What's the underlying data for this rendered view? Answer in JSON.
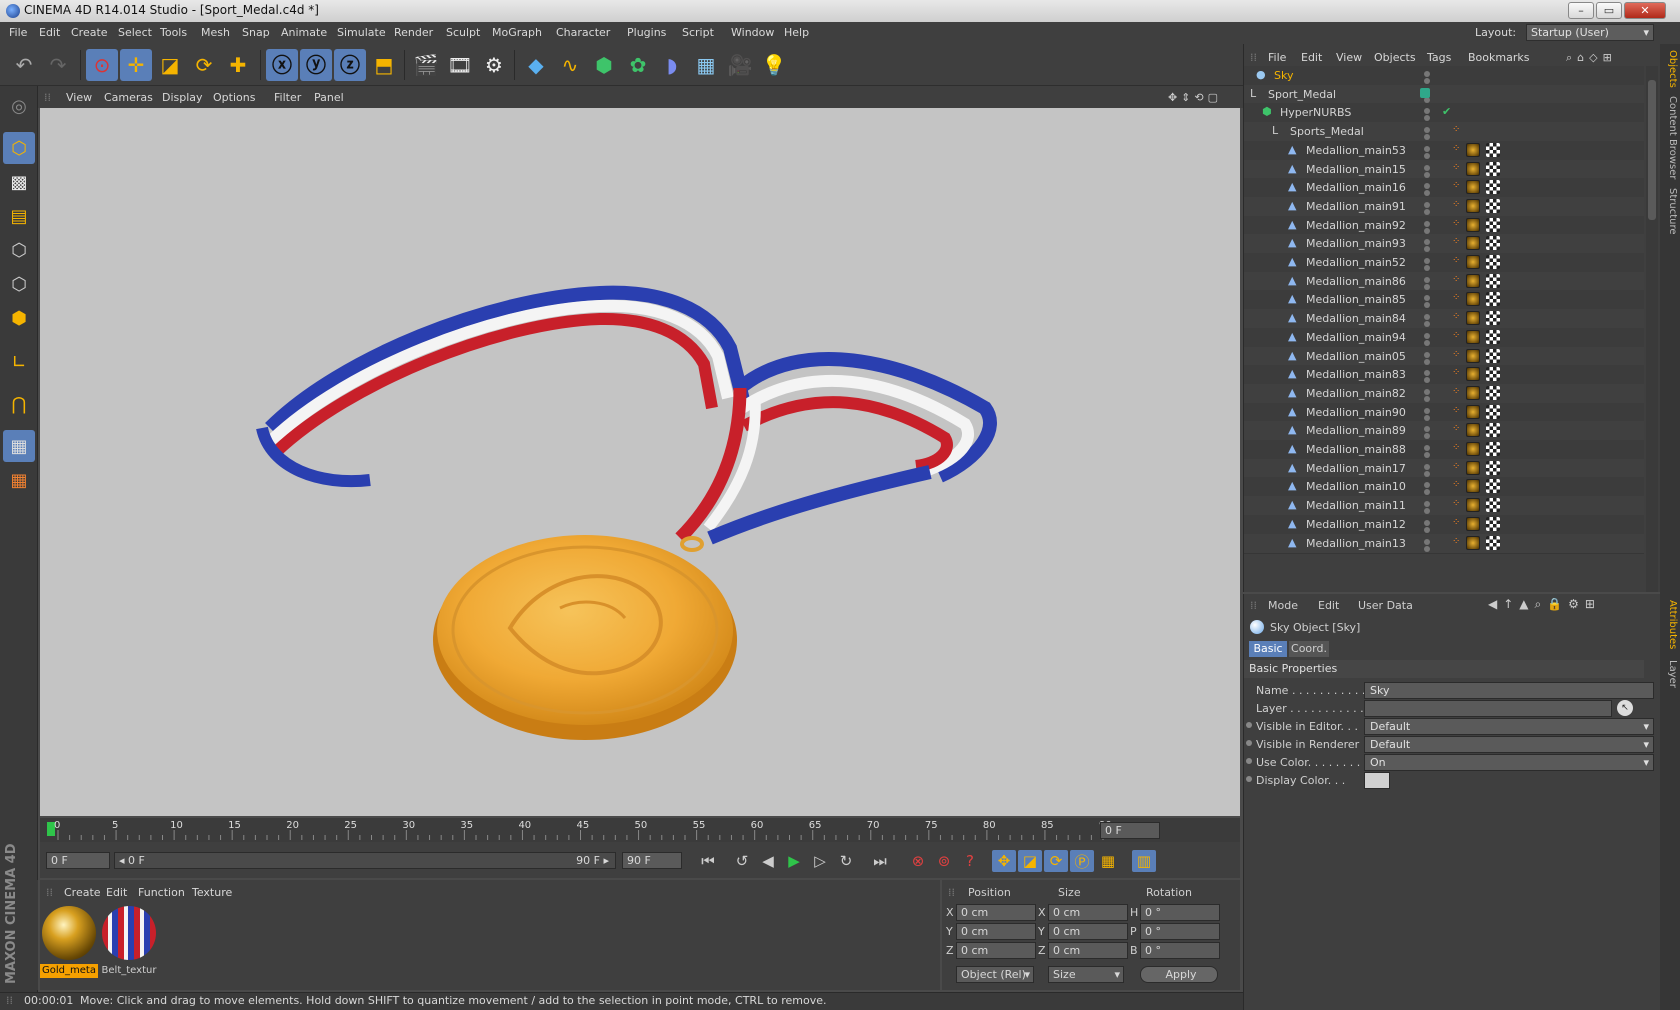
{
  "window": {
    "title": "CINEMA 4D R14.014 Studio - [Sport_Medal.c4d *]"
  },
  "menubar": {
    "items": [
      "File",
      "Edit",
      "Create",
      "Select",
      "Tools",
      "Mesh",
      "Snap",
      "Animate",
      "Simulate",
      "Render",
      "Sculpt",
      "MoGraph",
      "Character",
      "Plugins",
      "Script",
      "Window",
      "Help"
    ],
    "layout_label": "Layout:",
    "layout_value": "Startup (User)"
  },
  "viewport": {
    "menu": [
      "View",
      "Cameras",
      "Display",
      "Options",
      "Filter",
      "Panel"
    ]
  },
  "timeline": {
    "ticks": [
      "0",
      "5",
      "10",
      "15",
      "20",
      "25",
      "30",
      "35",
      "40",
      "45",
      "50",
      "55",
      "60",
      "65",
      "70",
      "75",
      "80",
      "85",
      "90"
    ],
    "end_field": "0 F"
  },
  "transport": {
    "current_frame": "0 F",
    "range_start": "◂ 0 F",
    "range_end": "90 F ▸",
    "max_frame": "90 F"
  },
  "materials": {
    "menu": [
      "Create",
      "Edit",
      "Function",
      "Texture"
    ],
    "items": [
      {
        "label": "Gold_meta"
      },
      {
        "label": "Belt_textur"
      }
    ]
  },
  "coords": {
    "headers": [
      "Position",
      "Size",
      "Rotation"
    ],
    "rows": [
      {
        "axis": "X",
        "pos": "0 cm",
        "saxis": "X",
        "size": "0 cm",
        "raxis": "H",
        "rot": "0 °"
      },
      {
        "axis": "Y",
        "pos": "0 cm",
        "saxis": "Y",
        "size": "0 cm",
        "raxis": "P",
        "rot": "0 °"
      },
      {
        "axis": "Z",
        "pos": "0 cm",
        "saxis": "Z",
        "size": "0 cm",
        "raxis": "B",
        "rot": "0 °"
      }
    ],
    "mode_select": "Object (Rel)",
    "size_select": "Size",
    "apply": "Apply"
  },
  "maxon_logo": "MAXON CINEMA 4D",
  "status": {
    "time": "00:00:01",
    "message": "Move: Click and drag to move elements. Hold down SHIFT to quantize movement / add to the selection in point mode, CTRL to remove."
  },
  "objects": {
    "menu": [
      "File",
      "Edit",
      "View",
      "Objects",
      "Tags",
      "Bookmarks"
    ],
    "tree": [
      {
        "name": "Sky"
      },
      {
        "name": "Sport_Medal"
      },
      {
        "name": "HyperNURBS"
      },
      {
        "name": "Sports_Medal"
      }
    ],
    "meshes": [
      "Medallion_main53",
      "Medallion_main15",
      "Medallion_main16",
      "Medallion_main91",
      "Medallion_main92",
      "Medallion_main93",
      "Medallion_main52",
      "Medallion_main86",
      "Medallion_main85",
      "Medallion_main84",
      "Medallion_main94",
      "Medallion_main05",
      "Medallion_main83",
      "Medallion_main82",
      "Medallion_main90",
      "Medallion_main89",
      "Medallion_main88",
      "Medallion_main17",
      "Medallion_main10",
      "Medallion_main11",
      "Medallion_main12",
      "Medallion_main13"
    ]
  },
  "attributes": {
    "menu": [
      "Mode",
      "Edit",
      "User Data"
    ],
    "object_title": "Sky Object [Sky]",
    "tabs": [
      "Basic",
      "Coord."
    ],
    "section": "Basic Properties",
    "fields": [
      {
        "label": "Name . . . . . . . . . . .",
        "value": "Sky"
      },
      {
        "label": "Layer . . . . . . . . . . . .",
        "value": ""
      },
      {
        "label": "Visible in Editor. . .",
        "value": "Default"
      },
      {
        "label": "Visible in Renderer",
        "value": "Default"
      },
      {
        "label": "Use Color. . . . . . . .",
        "value": "On"
      },
      {
        "label": "Display Color. . .",
        "value": ""
      }
    ]
  },
  "right_tabs": [
    "Objects",
    "Content Browser",
    "Structure",
    "Attributes",
    "Layer"
  ]
}
